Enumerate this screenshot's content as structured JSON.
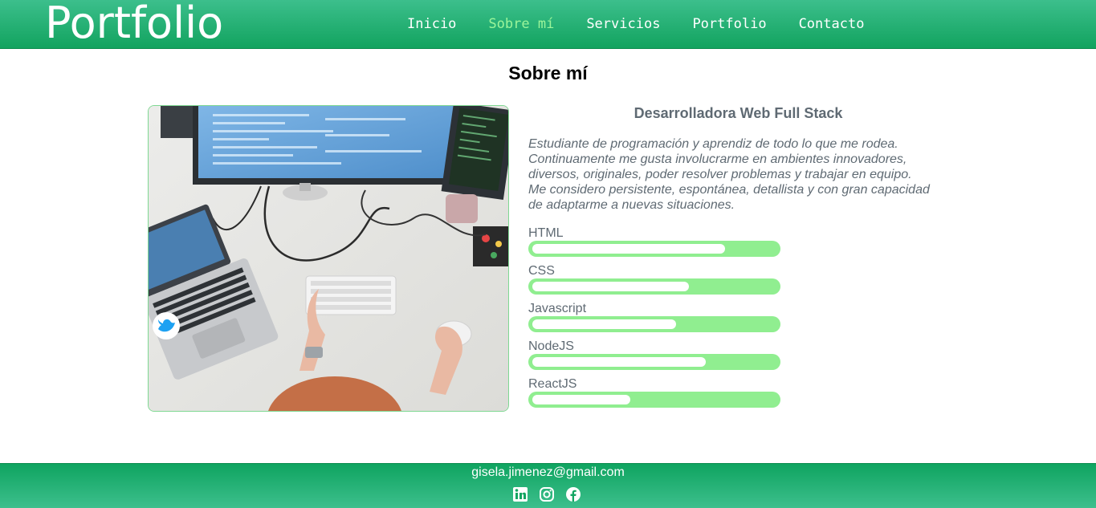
{
  "header": {
    "logo": "Portfolio",
    "nav": [
      {
        "label": "Inicio",
        "active": false
      },
      {
        "label": "Sobre mí",
        "active": true
      },
      {
        "label": "Servicios",
        "active": false
      },
      {
        "label": "Portfolio",
        "active": false
      },
      {
        "label": "Contacto",
        "active": false
      }
    ]
  },
  "about": {
    "title": "Sobre mí",
    "image_alt": "workspace-desk-photo",
    "role": "Desarrolladora Web Full Stack",
    "bio": "Estudiante de programación y aprendiz de todo lo que me rodea. Continuamente me gusta involucrarme en ambientes innovadores, diversos, originales, poder resolver problemas y trabajar en equipo. Me considero persistente, espontánea, detallista y con gran capacidad de adaptarme a nuevas situaciones.",
    "skills": [
      {
        "name": "HTML",
        "level_percent": 79
      },
      {
        "name": "CSS",
        "level_percent": 64
      },
      {
        "name": "Javascript",
        "level_percent": 59
      },
      {
        "name": "NodeJS",
        "level_percent": 71
      },
      {
        "name": "ReactJS",
        "level_percent": 40
      }
    ]
  },
  "footer": {
    "email": "gisela.jimenez@gmail.com",
    "social_icons": [
      "linkedin-icon",
      "instagram-icon",
      "facebook-icon"
    ]
  },
  "colors": {
    "header_green": "#12a35f",
    "nav_active": "#9cf59a",
    "skill_track": "#90ee90",
    "text_gray": "#5f6a73"
  }
}
